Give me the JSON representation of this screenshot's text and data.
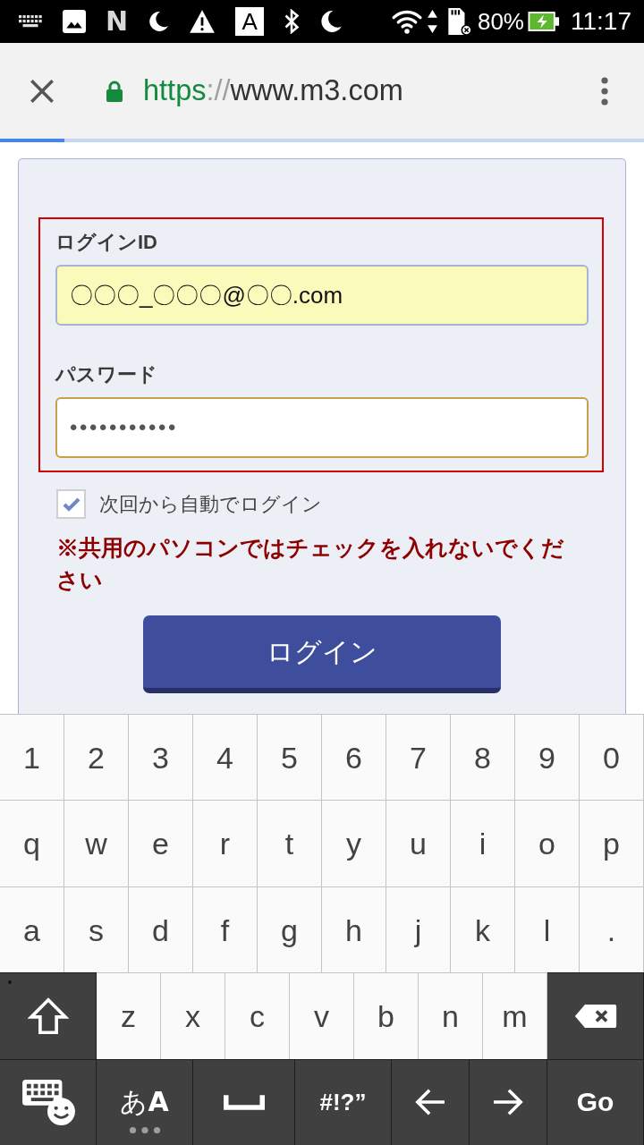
{
  "status_bar": {
    "logo_letter": "N",
    "app_badge": "A",
    "battery": "80%",
    "time": "11:17"
  },
  "browser": {
    "secure": true,
    "url_scheme": "https",
    "url_separator": "://",
    "url_host": "www.m3.com",
    "progress": {
      "level": 0.1
    }
  },
  "login_form": {
    "fields": [
      {
        "label": "ログインID",
        "value": "〇〇〇_〇〇〇@〇〇.com",
        "autofilled": true,
        "focused": false
      },
      {
        "label": "パスワード",
        "value": "•••••••••••",
        "autofilled": false,
        "focused": true
      }
    ],
    "remember": {
      "label": "次回から自動でログイン",
      "checked": true
    },
    "warning": "※共用のパソコンではチェックを入れないでください",
    "submit": "ログイン"
  },
  "keyboard": {
    "rows": [
      {
        "keys": [
          {
            "kind": "char",
            "label": "1"
          },
          {
            "kind": "char",
            "label": "2"
          },
          {
            "kind": "char",
            "label": "3"
          },
          {
            "kind": "char",
            "label": "4"
          },
          {
            "kind": "char",
            "label": "5"
          },
          {
            "kind": "char",
            "label": "6"
          },
          {
            "kind": "char",
            "label": "7"
          },
          {
            "kind": "char",
            "label": "8"
          },
          {
            "kind": "char",
            "label": "9"
          },
          {
            "kind": "char",
            "label": "0"
          }
        ]
      },
      {
        "keys": [
          {
            "kind": "char",
            "label": "q"
          },
          {
            "kind": "char",
            "label": "w"
          },
          {
            "kind": "char",
            "label": "e"
          },
          {
            "kind": "char",
            "label": "r"
          },
          {
            "kind": "char",
            "label": "t"
          },
          {
            "kind": "char",
            "label": "y"
          },
          {
            "kind": "char",
            "label": "u"
          },
          {
            "kind": "char",
            "label": "i"
          },
          {
            "kind": "char",
            "label": "o"
          },
          {
            "kind": "char",
            "label": "p"
          }
        ]
      },
      {
        "keys": [
          {
            "kind": "char",
            "label": "a"
          },
          {
            "kind": "char",
            "label": "s"
          },
          {
            "kind": "char",
            "label": "d"
          },
          {
            "kind": "char",
            "label": "f"
          },
          {
            "kind": "char",
            "label": "g"
          },
          {
            "kind": "char",
            "label": "h"
          },
          {
            "kind": "char",
            "label": "j"
          },
          {
            "kind": "char",
            "label": "k"
          },
          {
            "kind": "char",
            "label": "l"
          },
          {
            "kind": "char",
            "label": "."
          }
        ]
      },
      {
        "keys": [
          {
            "kind": "shift"
          },
          {
            "kind": "char",
            "label": "z"
          },
          {
            "kind": "char",
            "label": "x"
          },
          {
            "kind": "char",
            "label": "c"
          },
          {
            "kind": "char",
            "label": "v"
          },
          {
            "kind": "char",
            "label": "b"
          },
          {
            "kind": "char",
            "label": "n"
          },
          {
            "kind": "char",
            "label": "m"
          },
          {
            "kind": "backspace"
          }
        ]
      },
      {
        "keys": [
          {
            "kind": "settings"
          },
          {
            "kind": "mode",
            "label": "あ**A**"
          },
          {
            "kind": "space"
          },
          {
            "kind": "symbols",
            "label": "#!?”"
          },
          {
            "kind": "left"
          },
          {
            "kind": "right"
          },
          {
            "kind": "go",
            "label": "Go"
          }
        ]
      }
    ]
  }
}
